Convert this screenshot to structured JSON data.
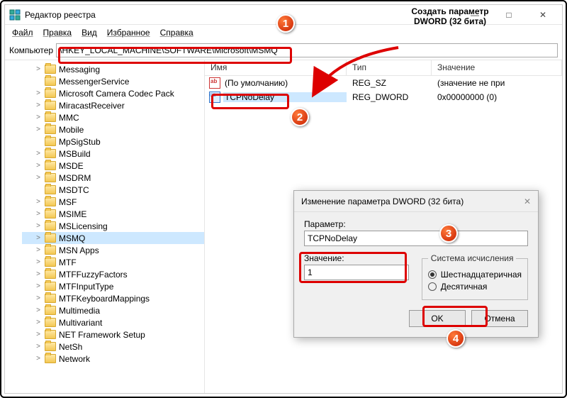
{
  "window": {
    "title": "Редактор реестра"
  },
  "menu": {
    "file": "Файл",
    "edit": "Правка",
    "view": "Вид",
    "fav": "Избранное",
    "help": "Справка"
  },
  "addr": {
    "label": "Компьютер",
    "path": "\\HKEY_LOCAL_MACHINE\\SOFTWARE\\Microsoft\\MSMQ"
  },
  "tree": [
    {
      "l": "Messaging",
      "e": ">"
    },
    {
      "l": "MessengerService",
      "e": ""
    },
    {
      "l": "Microsoft Camera Codec Pack",
      "e": ">"
    },
    {
      "l": "MiracastReceiver",
      "e": ">"
    },
    {
      "l": "MMC",
      "e": ">"
    },
    {
      "l": "Mobile",
      "e": ">"
    },
    {
      "l": "MpSigStub",
      "e": ""
    },
    {
      "l": "MSBuild",
      "e": ">"
    },
    {
      "l": "MSDE",
      "e": ">"
    },
    {
      "l": "MSDRM",
      "e": ">"
    },
    {
      "l": "MSDTC",
      "e": ""
    },
    {
      "l": "MSF",
      "e": ">"
    },
    {
      "l": "MSIME",
      "e": ">"
    },
    {
      "l": "MSLicensing",
      "e": ">"
    },
    {
      "l": "MSMQ",
      "e": ">",
      "sel": true
    },
    {
      "l": "MSN Apps",
      "e": ">"
    },
    {
      "l": "MTF",
      "e": ">"
    },
    {
      "l": "MTFFuzzyFactors",
      "e": ">"
    },
    {
      "l": "MTFInputType",
      "e": ">"
    },
    {
      "l": "MTFKeyboardMappings",
      "e": ">"
    },
    {
      "l": "Multimedia",
      "e": ">"
    },
    {
      "l": "Multivariant",
      "e": ">"
    },
    {
      "l": "NET Framework Setup",
      "e": ">"
    },
    {
      "l": "NetSh",
      "e": ">"
    },
    {
      "l": "Network",
      "e": ">"
    }
  ],
  "cols": {
    "name": "Имя",
    "type": "Тип",
    "value": "Значение"
  },
  "rows": [
    {
      "icon": "str",
      "name": "(По умолчанию)",
      "type": "REG_SZ",
      "value": "(значение не при"
    },
    {
      "icon": "dw",
      "name": "TCPNoDelay",
      "type": "REG_DWORD",
      "value": "0x00000000 (0)",
      "sel": true
    }
  ],
  "dlg": {
    "title": "Изменение параметра DWORD (32 бита)",
    "paramLabel": "Параметр:",
    "paramValue": "TCPNoDelay",
    "valueLabel": "Значение:",
    "valueValue": "1",
    "baseLegend": "Система исчисления",
    "hex": "Шестнадцатеричная",
    "dec": "Десятичная",
    "ok": "OK",
    "cancel": "Отмена"
  },
  "callout": {
    "line1": "Создать параметр",
    "line2": "DWORD (32 бита)"
  }
}
